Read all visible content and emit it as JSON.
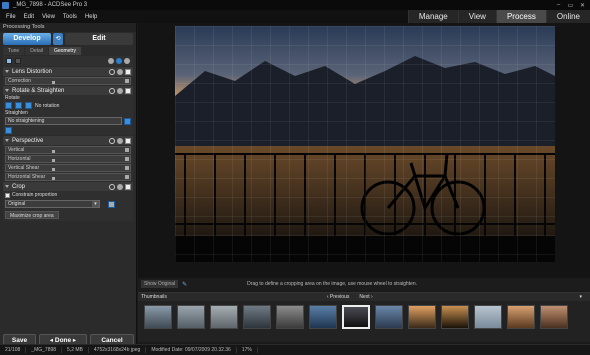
{
  "window": {
    "title": "_MG_7898 - ACDSee Pro 3",
    "controls": [
      "–",
      "▭",
      "✕"
    ]
  },
  "menu": [
    "File",
    "Edit",
    "View",
    "Tools",
    "Help"
  ],
  "modes": [
    {
      "label": "Manage",
      "active": false
    },
    {
      "label": "View",
      "active": false
    },
    {
      "label": "Process",
      "active": true
    },
    {
      "label": "Online",
      "active": false
    }
  ],
  "panel": {
    "title": "Processing Tools",
    "develop_label": "Develop",
    "edit_label": "Edit",
    "subtabs": [
      "Tune",
      "Detail",
      "Geometry"
    ],
    "sections": {
      "lens": {
        "label": "Lens Distortion",
        "correction": "Correction"
      },
      "rotate": {
        "label": "Rotate & Straighten",
        "rotate_label": "Rotate",
        "no_rotation": "No rotation",
        "straighten_label": "Straighten",
        "no_straightening": "No straightening"
      },
      "perspective": {
        "label": "Perspective",
        "sliders": [
          "Vertical",
          "Horizontal",
          "Vertical Shear",
          "Horizontal Shear"
        ]
      },
      "crop": {
        "label": "Crop",
        "constrain": "Constrain proportion",
        "ratio": "Original",
        "maximize": "Maximize crop area"
      }
    },
    "buttons": {
      "save": "Save",
      "done": "Done",
      "cancel": "Cancel"
    }
  },
  "viewer": {
    "show_original": "Show Original",
    "hint": "Drag to define a cropping area on the image, use mouse wheel to straighten."
  },
  "thumbnails": {
    "title": "Thumbnails",
    "previous": "‹ Previous",
    "next": "Next ›",
    "items": [
      {
        "c1": "#8a9aa8",
        "c2": "#3f4a55"
      },
      {
        "c1": "#9aa5ae",
        "c2": "#545e66"
      },
      {
        "c1": "#a6aeb3",
        "c2": "#5e666b"
      },
      {
        "c1": "#6e7a84",
        "c2": "#2c343b"
      },
      {
        "c1": "#8c8c8c",
        "c2": "#3a3a3a"
      },
      {
        "c1": "#5a7ea8",
        "c2": "#1f3650"
      },
      {
        "c1": "#4a4a54",
        "c2": "#111"
      },
      {
        "c1": "#6a86a8",
        "c2": "#2b3a50"
      },
      {
        "c1": "#e0a060",
        "c2": "#3a2a1a"
      },
      {
        "c1": "#c89050",
        "c2": "#1a1208"
      },
      {
        "c1": "#b8c4d0",
        "c2": "#7a8a9a"
      },
      {
        "c1": "#d8a070",
        "c2": "#5a3a20"
      },
      {
        "c1": "#c09070",
        "c2": "#4a3020"
      }
    ],
    "active_index": 6
  },
  "status": {
    "index": "21/108",
    "filename": "_MG_7898",
    "size": "5,2 MB",
    "info": "4752x3168x24b jpeg",
    "modified": "Modified Date: 09/07/2009 20.32.36",
    "zoom": "17%"
  }
}
